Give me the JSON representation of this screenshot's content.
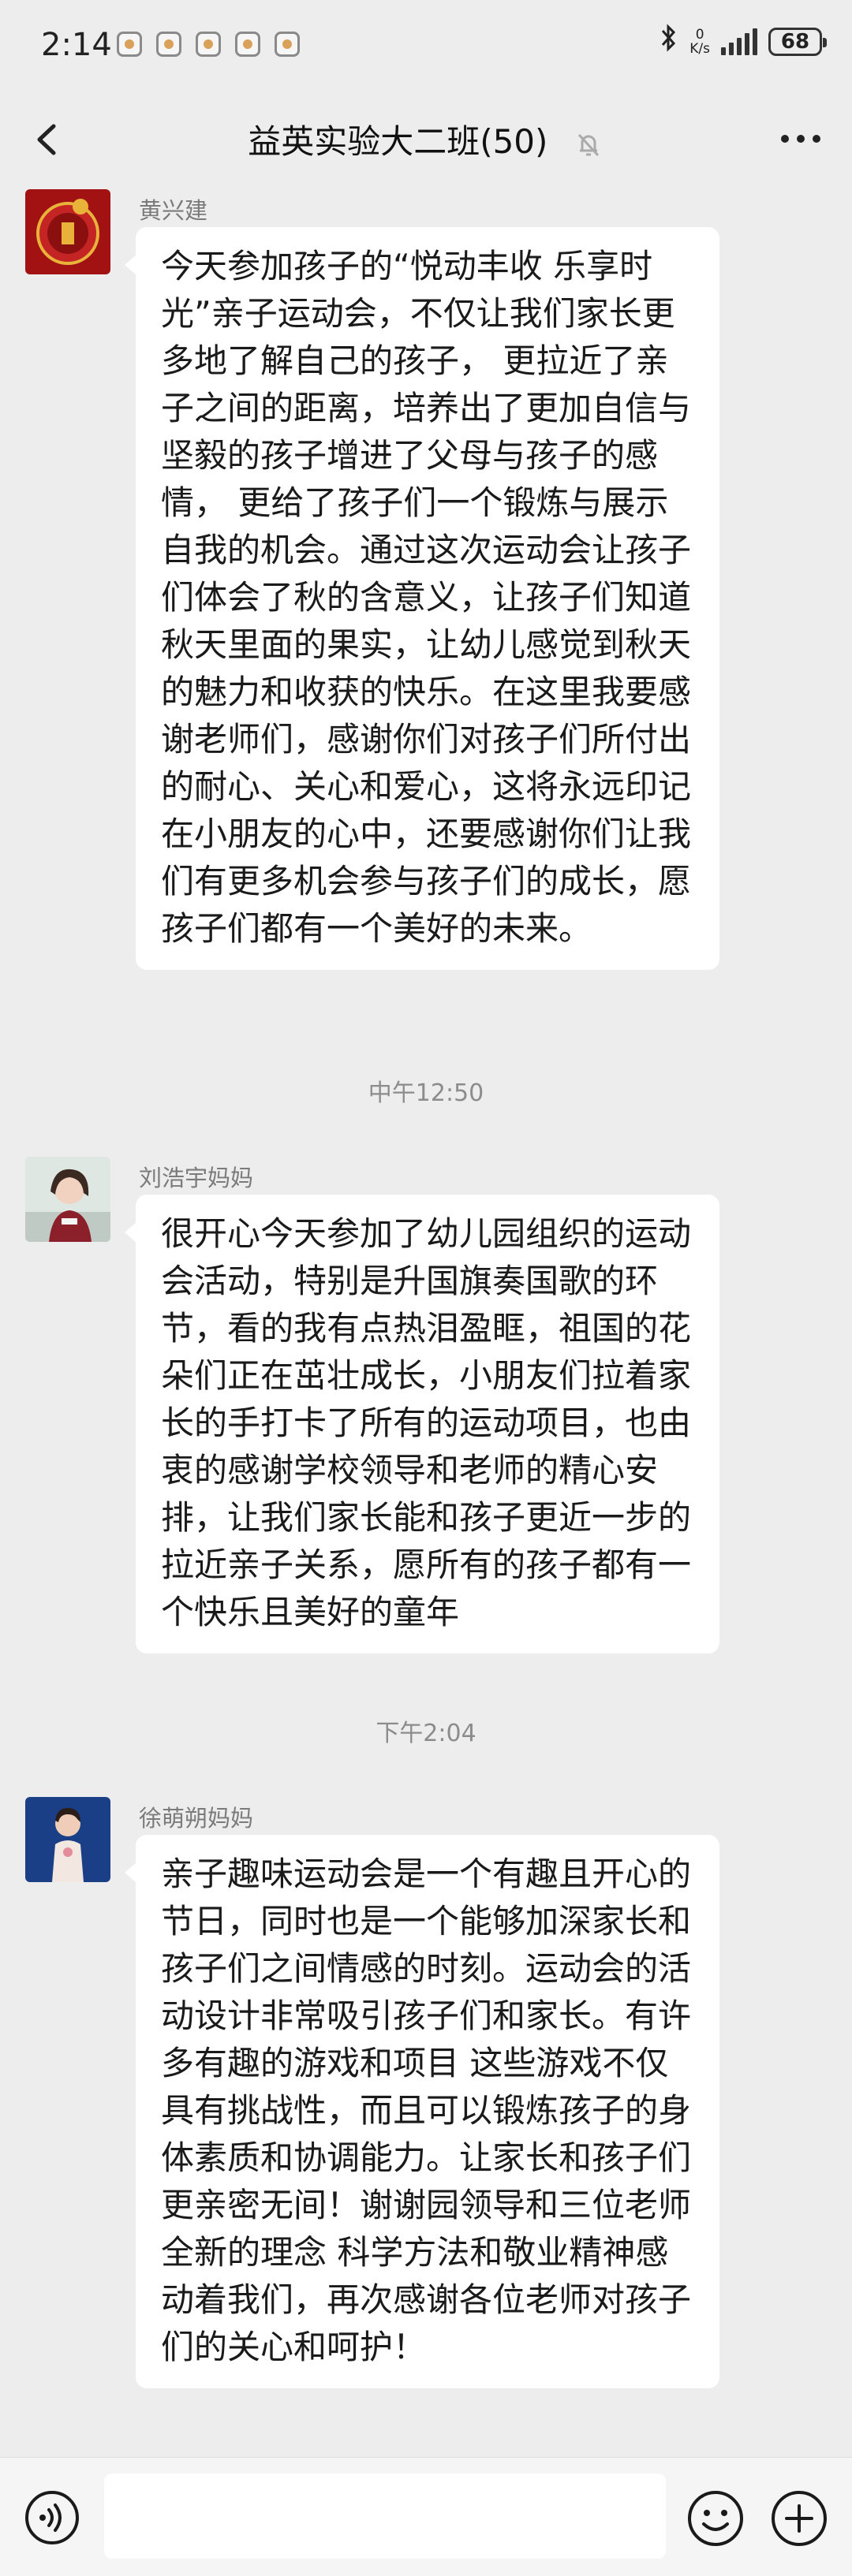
{
  "status_bar": {
    "time": "2:14",
    "net_speed_value": "0",
    "net_speed_unit": "K/s",
    "battery": "68"
  },
  "nav": {
    "title": "益英实验大二班(50)"
  },
  "messages": [
    {
      "sender": "黄兴建",
      "text": "今天参加孩子的“悦动丰收 乐享时光”亲子运动会，不仅让我们家长更多地了解自己的孩子， 更拉近了亲子之间的距离，培养出了更加自信与坚毅的孩子增进了父母与孩子的感情， 更给了孩子们一个锻炼与展示自我的机会。通过这次运动会让孩子们体会了秋的含意义，让孩子们知道秋天里面的果实，让幼儿感觉到秋天的魅力和收获的快乐。在这里我要感谢老师们，感谢你们对孩子们所付出的耐心、关心和爱心，这将永远印记在小朋友的心中，还要感谢你们让我们有更多机会参与孩子们的成长，愿孩子们都有一个美好的未来。"
    },
    {
      "sender": "刘浩宇妈妈",
      "text": "很开心今天参加了幼儿园组织的运动会活动，特别是升国旗奏国歌的环节，看的我有点热泪盈眶，祖国的花朵们正在茁壮成长，小朋友们拉着家长的手打卡了所有的运动项目，也由衷的感谢学校领导和老师的精心安排，让我们家长能和孩子更近一步的拉近亲子关系，愿所有的孩子都有一个快乐且美好的童年"
    },
    {
      "sender": "徐萌朔妈妈",
      "text": "亲子趣味运动会是一个有趣且开心的节日，同时也是一个能够加深家长和孩子们之间情感的时刻。运动会的活动设计非常吸引孩子们和家长。有许多有趣的游戏和项目 这些游戏不仅具有挑战性，而且可以锻炼孩子的身体素质和协调能力。让家长和孩子们更亲密无间！谢谢园领导和三位老师全新的理念 科学方法和敬业精神感动着我们，再次感谢各位老师对孩子们的关心和呵护！"
    }
  ],
  "timestamps": [
    "中午12:50",
    "下午2:04"
  ],
  "input_bar": {
    "placeholder": ""
  },
  "icons": {
    "back": "back-arrow-icon",
    "mute": "mute-bell-icon",
    "more": "more-dots-icon",
    "voice": "voice-icon",
    "emoji": "emoji-icon",
    "plus": "plus-icon"
  }
}
